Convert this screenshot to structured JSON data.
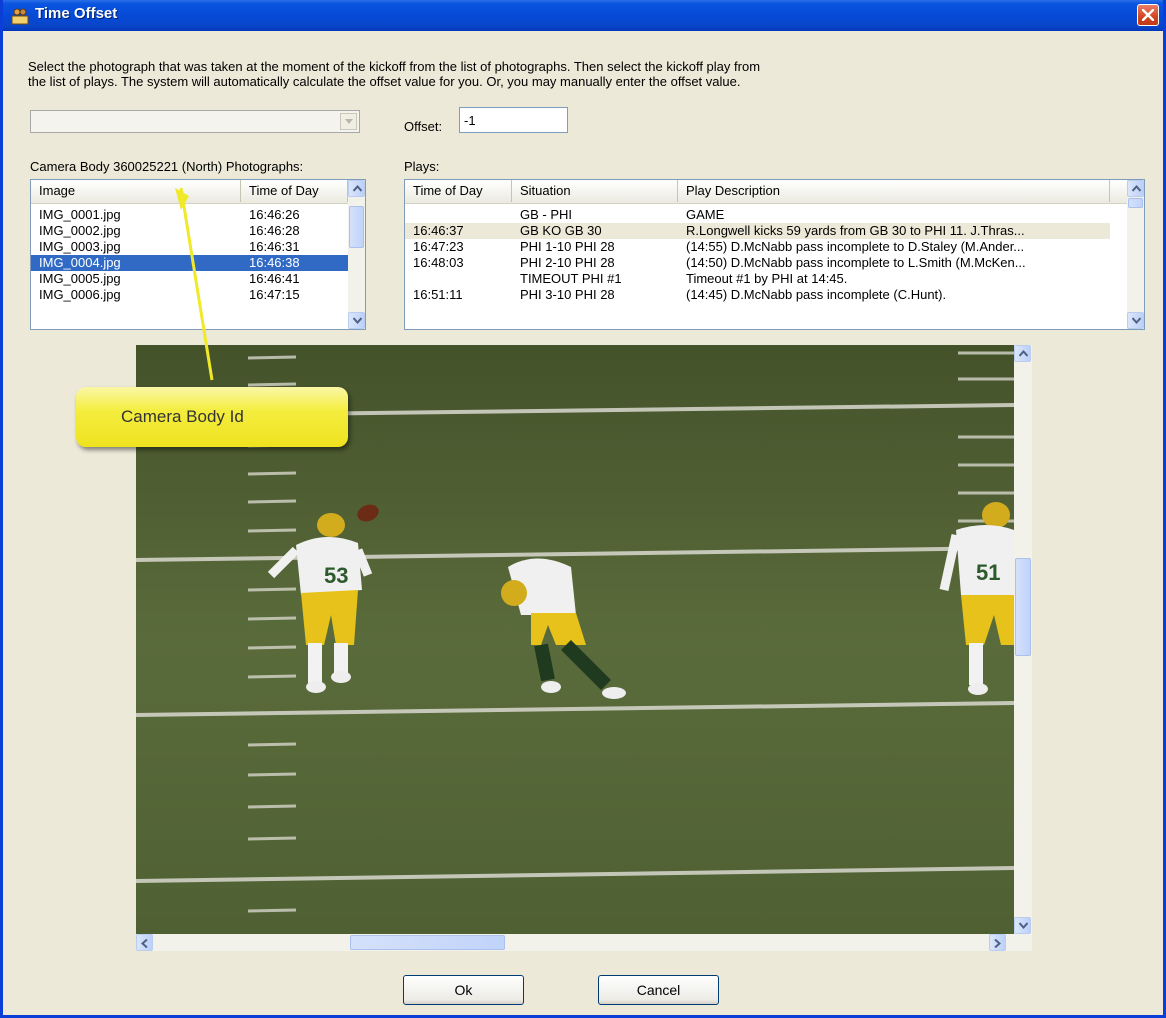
{
  "window": {
    "title": "Time Offset"
  },
  "instructions": {
    "line1": "Select the photograph that was taken at the moment of the kickoff from the list of photographs.  Then select the kickoff play from",
    "line2": "the list of plays.  The system will automatically calculate the offset value for you.  Or, you may manually enter the offset value."
  },
  "camera_combo": {
    "value": ""
  },
  "offset": {
    "label": "Offset:",
    "value": "-1"
  },
  "photos": {
    "label": "Camera Body 360025221 (North) Photographs:",
    "columns": [
      "Image",
      "Time of Day"
    ],
    "rows": [
      {
        "image": "IMG_0001.jpg",
        "time": "16:46:26"
      },
      {
        "image": "IMG_0002.jpg",
        "time": "16:46:28"
      },
      {
        "image": "IMG_0003.jpg",
        "time": "16:46:31"
      },
      {
        "image": "IMG_0004.jpg",
        "time": "16:46:38"
      },
      {
        "image": "IMG_0005.jpg",
        "time": "16:46:41"
      },
      {
        "image": "IMG_0006.jpg",
        "time": "16:47:15"
      }
    ],
    "selected_index": 3
  },
  "plays": {
    "label": "Plays:",
    "columns": [
      "Time of Day",
      "Situation",
      "Play Description"
    ],
    "rows": [
      {
        "time": "",
        "situation": "GB - PHI",
        "description": "GAME"
      },
      {
        "time": "16:46:37",
        "situation": "GB  KO  GB 30",
        "description": "R.Longwell kicks 59 yards from GB 30 to PHI 11. J.Thras..."
      },
      {
        "time": "16:47:23",
        "situation": "PHI  1-10  PHI 28",
        "description": "(14:55) D.McNabb pass incomplete to D.Staley (M.Ander..."
      },
      {
        "time": "16:48:03",
        "situation": "PHI  2-10  PHI 28",
        "description": "(14:50) D.McNabb pass incomplete to L.Smith (M.McKen..."
      },
      {
        "time": "",
        "situation": "TIMEOUT PHI #1",
        "description": "Timeout #1 by PHI at 14:45."
      },
      {
        "time": "16:51:11",
        "situation": "PHI  3-10  PHI 28",
        "description": "(14:45) D.McNabb pass incomplete (C.Hunt)."
      }
    ],
    "highlighted_index": 1
  },
  "callout": {
    "text": "Camera Body Id"
  },
  "buttons": {
    "ok": "Ok",
    "cancel": "Cancel"
  },
  "jerseys": [
    "53",
    "51"
  ],
  "colors": {
    "title_bar": "#0649d6",
    "selection": "#316ac5",
    "field_green": "#55663a",
    "callout_yellow": "#f4ed3e",
    "jersey_gold": "#e7c21a"
  }
}
